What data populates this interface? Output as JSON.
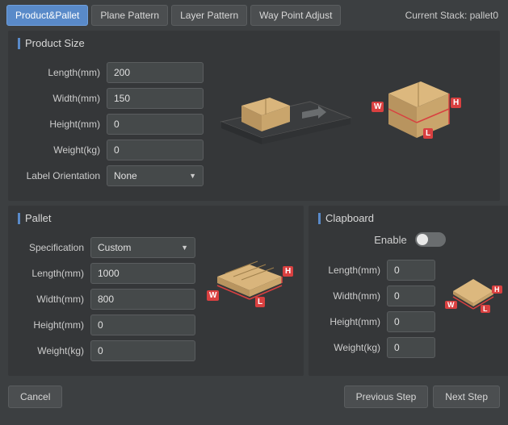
{
  "header": {
    "tabs": [
      {
        "label": "Product&Pallet",
        "active": true
      },
      {
        "label": "Plane Pattern",
        "active": false
      },
      {
        "label": "Layer Pattern",
        "active": false
      },
      {
        "label": "Way Point Adjust",
        "active": false
      }
    ],
    "stack_label": "Current Stack: pallet0"
  },
  "product": {
    "title": "Product Size",
    "length_label": "Length(mm)",
    "width_label": "Width(mm)",
    "height_label": "Height(mm)",
    "weight_label": "Weight(kg)",
    "orientation_label": "Label Orientation",
    "length_value": "200",
    "width_value": "150",
    "height_value": "0",
    "weight_value": "0",
    "orientation_value": "None",
    "dim_tags": {
      "w": "W",
      "l": "L",
      "h": "H"
    }
  },
  "pallet": {
    "title": "Pallet",
    "spec_label": "Specification",
    "spec_value": "Custom",
    "length_label": "Length(mm)",
    "width_label": "Width(mm)",
    "height_label": "Height(mm)",
    "weight_label": "Weight(kg)",
    "length_value": "1000",
    "width_value": "800",
    "height_value": "0",
    "weight_value": "0",
    "dim_tags": {
      "w": "W",
      "l": "L",
      "h": "H"
    }
  },
  "clapboard": {
    "title": "Clapboard",
    "enable_label": "Enable",
    "enabled": false,
    "length_label": "Length(mm)",
    "width_label": "Width(mm)",
    "height_label": "Height(mm)",
    "weight_label": "Weight(kg)",
    "length_value": "0",
    "width_value": "0",
    "height_value": "0",
    "weight_value": "0",
    "dim_tags": {
      "w": "W",
      "l": "L",
      "h": "H"
    }
  },
  "footer": {
    "cancel": "Cancel",
    "prev": "Previous Step",
    "next": "Next Step"
  }
}
